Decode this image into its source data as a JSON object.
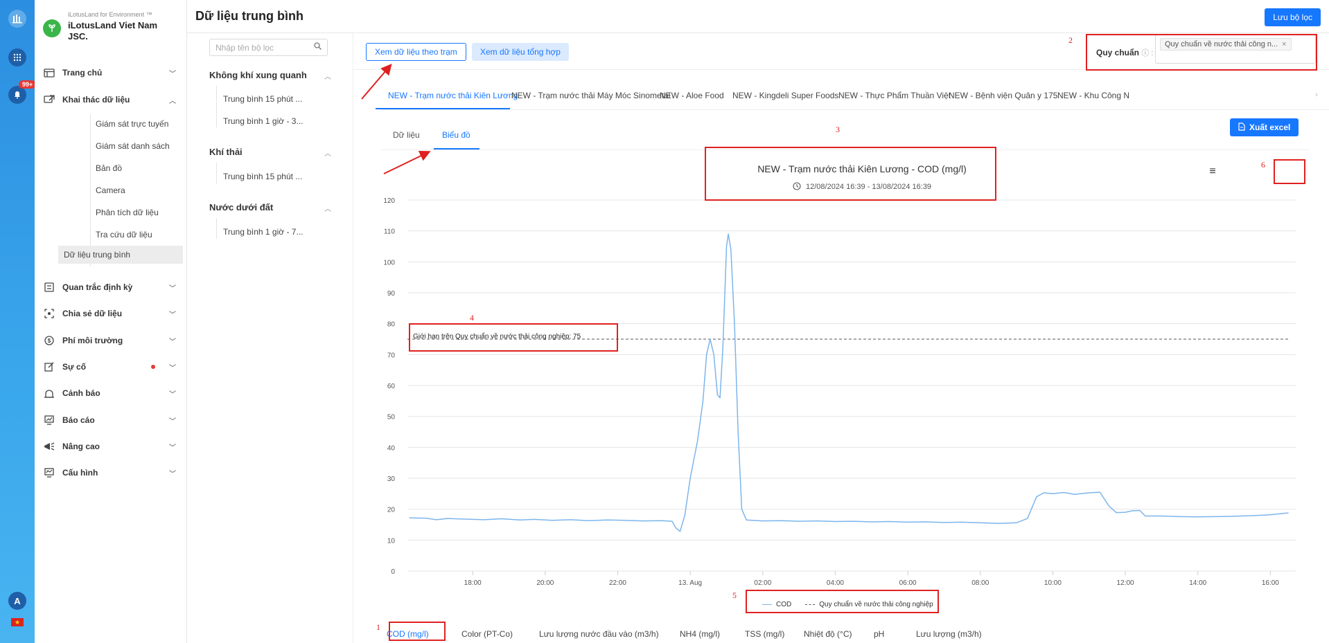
{
  "rail": {
    "badge": "99+",
    "avatar": "A",
    "flag": "★"
  },
  "brand": {
    "sub": "iLotusLand for Environment ™",
    "name": "iLotusLand Viet Nam JSC."
  },
  "nav": {
    "items": [
      {
        "label": "Trang chủ",
        "icon": "home-icon"
      },
      {
        "label": "Khai thác dữ liệu",
        "icon": "data-mining-icon"
      },
      {
        "label": "Quan trắc định kỳ",
        "icon": "periodic-icon"
      },
      {
        "label": "Chia sẻ dữ liệu",
        "icon": "share-icon"
      },
      {
        "label": "Phí môi trường",
        "icon": "fee-icon"
      },
      {
        "label": "Sự cố",
        "icon": "incident-icon"
      },
      {
        "label": "Cảnh báo",
        "icon": "alert-icon"
      },
      {
        "label": "Báo cáo",
        "icon": "report-icon"
      },
      {
        "label": "Nâng cao",
        "icon": "advanced-icon"
      },
      {
        "label": "Cấu hình",
        "icon": "config-icon"
      }
    ],
    "sub_items": [
      "Giám sát trực tuyến",
      "Giám sát danh sách",
      "Bản đồ",
      "Camera",
      "Phân tích dữ liệu",
      "Tra cứu dữ liệu",
      "Dữ liệu trung bình"
    ]
  },
  "header": {
    "title": "Dữ liệu trung bình",
    "save_filter": "Lưu bộ lọc"
  },
  "filter": {
    "search_placeholder": "Nhập tên bộ lọc",
    "groups": [
      {
        "title": "Không khí xung quanh",
        "items": [
          "Trung bình 15 phút ...",
          "Trung bình 1 giờ - 3..."
        ]
      },
      {
        "title": "Khí thải",
        "items": [
          "Trung bình 15 phút ..."
        ]
      },
      {
        "title": "Nước dưới đất",
        "items": [
          "Trung bình 1 giờ - 7..."
        ]
      }
    ]
  },
  "main": {
    "view_by_station": "Xem dữ liệu theo trạm",
    "view_summary": "Xem dữ liệu tổng hợp",
    "standard_label": "Quy chuẩn",
    "standard_tag": "Quy chuẩn về nước thải công n...",
    "station_tabs": [
      "NEW - Trạm nước thải Kiên Lương",
      "NEW - Trạm nước thải Máy Móc Sinometal",
      "NEW - Aloe Food",
      "NEW - Kingdeli Super Foods",
      "NEW - Thực Phẩm Thuần Việt",
      "NEW - Bệnh viện Quân y 175",
      "NEW - Khu Công N"
    ],
    "view_tabs": [
      "Dữ liệu",
      "Biểu đồ"
    ],
    "export_excel": "Xuất excel",
    "param_tabs": [
      "COD (mg/l)",
      "Color (PT-Co)",
      "Lưu lượng nước đầu vào (m3/h)",
      "NH4 (mg/l)",
      "TSS (mg/l)",
      "Nhiệt độ (°C)",
      "pH",
      "Lưu lượng (m3/h)"
    ]
  },
  "annotations": [
    "1",
    "2",
    "3",
    "4",
    "5",
    "6"
  ],
  "chart_data": {
    "type": "line",
    "title": "NEW - Trạm nước thải Kiên Lương - COD (mg/l)",
    "subtitle": "12/08/2024 16:39 - 13/08/2024 16:39",
    "ylim": [
      0,
      120
    ],
    "y_ticks": [
      "0",
      "10",
      "20",
      "30",
      "40",
      "50",
      "60",
      "70",
      "80",
      "90",
      "100",
      "110",
      "120"
    ],
    "x_ticks": [
      {
        "label": "18:00",
        "t": 18
      },
      {
        "label": "20:00",
        "t": 20
      },
      {
        "label": "22:00",
        "t": 22
      },
      {
        "label": "13. Aug",
        "t": 24
      },
      {
        "label": "02:00",
        "t": 26
      },
      {
        "label": "04:00",
        "t": 28
      },
      {
        "label": "06:00",
        "t": 30
      },
      {
        "label": "08:00",
        "t": 32
      },
      {
        "label": "10:00",
        "t": 34
      },
      {
        "label": "12:00",
        "t": 36
      },
      {
        "label": "14:00",
        "t": 38
      },
      {
        "label": "16:00",
        "t": 40
      }
    ],
    "xlim": [
      16.2,
      40.7
    ],
    "series": [
      {
        "name": "COD",
        "color": "#7cb5ec",
        "points": [
          [
            16.25,
            17.2
          ],
          [
            16.7,
            17.1
          ],
          [
            17.0,
            16.6
          ],
          [
            17.3,
            17.0
          ],
          [
            17.8,
            16.8
          ],
          [
            18.3,
            16.6
          ],
          [
            18.8,
            16.9
          ],
          [
            19.3,
            16.5
          ],
          [
            19.7,
            16.7
          ],
          [
            20.2,
            16.4
          ],
          [
            20.7,
            16.6
          ],
          [
            21.2,
            16.3
          ],
          [
            21.7,
            16.5
          ],
          [
            22.2,
            16.4
          ],
          [
            22.7,
            16.2
          ],
          [
            23.2,
            16.3
          ],
          [
            23.5,
            16.1
          ],
          [
            23.6,
            14.0
          ],
          [
            23.72,
            12.8
          ],
          [
            23.85,
            18.0
          ],
          [
            24.0,
            30.0
          ],
          [
            24.2,
            42.0
          ],
          [
            24.35,
            55.0
          ],
          [
            24.45,
            70.0
          ],
          [
            24.55,
            75.0
          ],
          [
            24.65,
            70.0
          ],
          [
            24.75,
            57.0
          ],
          [
            24.82,
            56.0
          ],
          [
            24.9,
            72.0
          ],
          [
            25.0,
            105.0
          ],
          [
            25.05,
            109.0
          ],
          [
            25.12,
            104.0
          ],
          [
            25.22,
            80.0
          ],
          [
            25.32,
            45.0
          ],
          [
            25.42,
            20.0
          ],
          [
            25.55,
            16.5
          ],
          [
            26.0,
            16.2
          ],
          [
            26.5,
            16.3
          ],
          [
            27.0,
            16.1
          ],
          [
            27.5,
            16.2
          ],
          [
            28.0,
            16.0
          ],
          [
            28.5,
            16.1
          ],
          [
            29.0,
            15.9
          ],
          [
            29.5,
            16.0
          ],
          [
            30.0,
            15.8
          ],
          [
            30.5,
            15.9
          ],
          [
            31.0,
            15.7
          ],
          [
            31.5,
            15.8
          ],
          [
            32.0,
            15.6
          ],
          [
            32.5,
            15.4
          ],
          [
            33.0,
            15.6
          ],
          [
            33.3,
            17.0
          ],
          [
            33.55,
            24.0
          ],
          [
            33.75,
            25.3
          ],
          [
            34.0,
            25.0
          ],
          [
            34.3,
            25.4
          ],
          [
            34.6,
            24.8
          ],
          [
            35.0,
            25.3
          ],
          [
            35.3,
            25.5
          ],
          [
            35.55,
            21.0
          ],
          [
            35.75,
            18.9
          ],
          [
            36.0,
            19.0
          ],
          [
            36.2,
            19.5
          ],
          [
            36.4,
            19.6
          ],
          [
            36.55,
            17.8
          ],
          [
            37.0,
            17.8
          ],
          [
            37.5,
            17.6
          ],
          [
            38.0,
            17.5
          ],
          [
            38.5,
            17.6
          ],
          [
            39.0,
            17.7
          ],
          [
            39.5,
            17.9
          ],
          [
            40.0,
            18.2
          ],
          [
            40.5,
            18.8
          ]
        ]
      }
    ],
    "threshold": {
      "name": "Quy chuẩn về nước thải công nghiệp",
      "value": 75,
      "label": "Giới hạn trên Quy chuẩn về nước thải công nghiệp: 75"
    }
  }
}
